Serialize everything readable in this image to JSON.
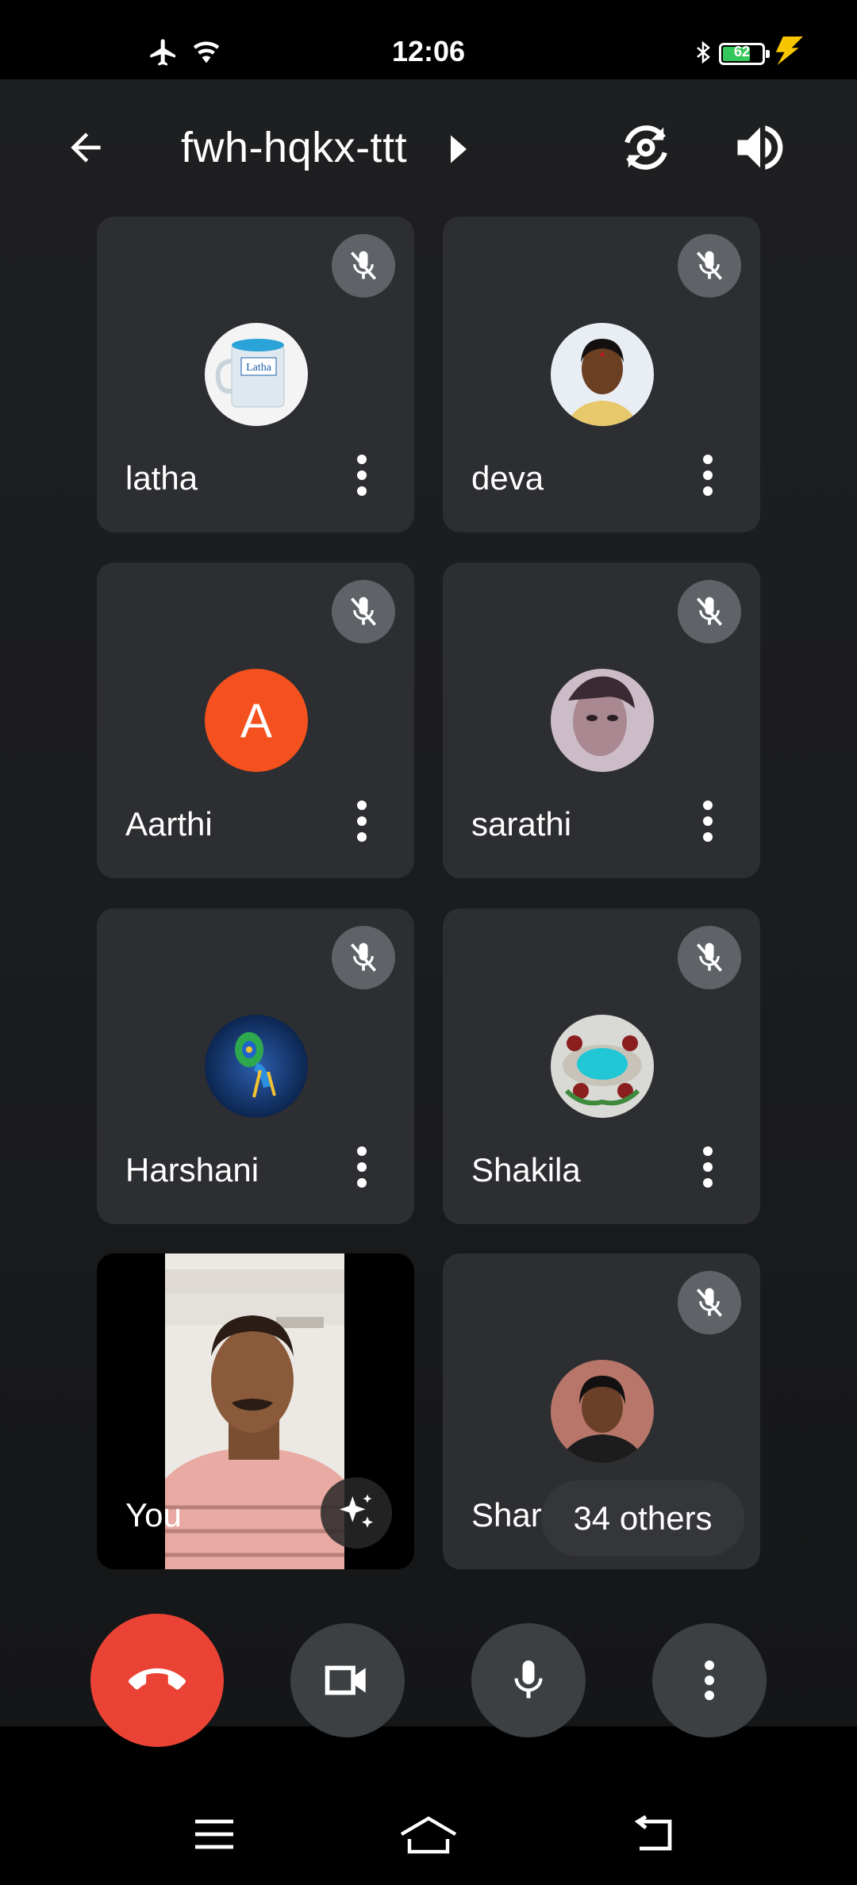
{
  "status_bar": {
    "time": "12:06",
    "battery_level": "62",
    "icons": [
      "airplane-icon",
      "wifi-icon",
      "bluetooth-icon",
      "battery-icon",
      "charging-icon"
    ]
  },
  "header": {
    "meeting_code": "fwh-hqkx-ttt",
    "icons": [
      "back-arrow-icon",
      "chevron-right-icon",
      "flip-camera-icon",
      "speaker-icon"
    ]
  },
  "participants": [
    {
      "name": "latha",
      "muted": true,
      "avatar": "photo-mug"
    },
    {
      "name": "deva",
      "muted": true,
      "avatar": "photo-woman"
    },
    {
      "name": "Aarthi",
      "muted": true,
      "avatar_letter": "A",
      "avatar_color": "#f4511e"
    },
    {
      "name": "sarathi",
      "muted": true,
      "avatar": "photo-face"
    },
    {
      "name": "Harshani",
      "muted": true,
      "avatar": "photo-krishna"
    },
    {
      "name": "Shakila",
      "muted": true,
      "avatar": "photo-emblem"
    },
    {
      "name": "You",
      "muted": false,
      "avatar": "self-video"
    },
    {
      "name": "Sharmila Banu",
      "muted": true,
      "avatar": "photo-woman-2"
    }
  ],
  "others_pill": "34 others",
  "controls": {
    "icons": [
      "end-call-icon",
      "camera-icon",
      "microphone-icon",
      "more-options-icon"
    ],
    "colors": {
      "end_call": "#ea4335",
      "button": "#3c4043"
    }
  },
  "nav": {
    "icons": [
      "menu-icon",
      "home-icon",
      "back-icon"
    ]
  }
}
